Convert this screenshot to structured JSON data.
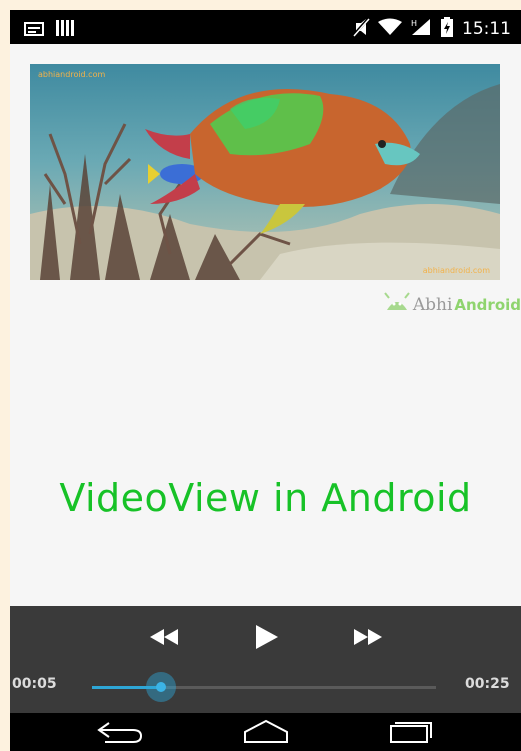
{
  "status_bar": {
    "time": "15:11",
    "left_icons": [
      "image-notification-icon",
      "bars-notification-icon"
    ],
    "right_icons": [
      "mute-icon",
      "wifi-icon",
      "signal-icon",
      "battery-icon"
    ]
  },
  "video": {
    "scene": "underwater parrotfish",
    "watermark_top_left": "abhiandroid.com",
    "watermark_bottom_right": "abhiandroid.com"
  },
  "brand": {
    "part1": "Abhi",
    "part2": "Android",
    "icon": "android-robot-icon"
  },
  "caption": "VideoView in Android",
  "controller": {
    "elapsed": "00:05",
    "duration": "00:25",
    "progress_fraction": 0.2,
    "buttons": [
      "rewind-icon",
      "play-icon",
      "fast-forward-icon"
    ]
  },
  "nav_bar": {
    "buttons": [
      "back-icon",
      "home-icon",
      "recents-icon"
    ]
  },
  "colors": {
    "caption": "#17c227",
    "accent": "#2ea6d6",
    "controller_bg": "#3a3a3a"
  }
}
